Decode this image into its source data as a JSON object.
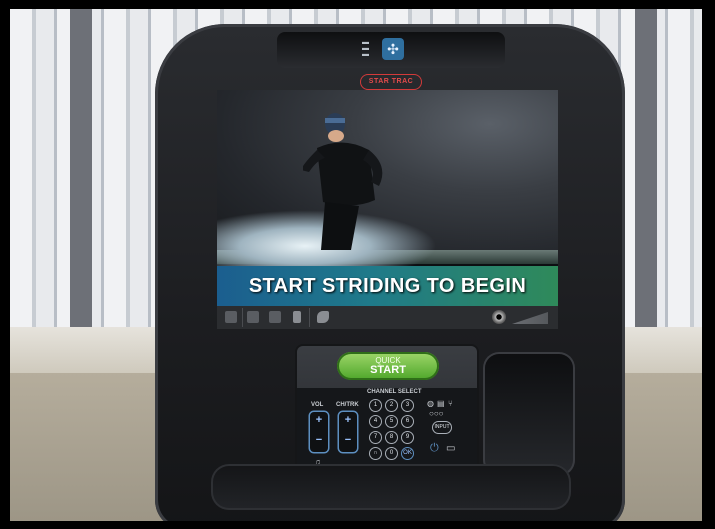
{
  "console": {
    "brand_logo": "STAR TRAC",
    "fan_icon": "fan-icon",
    "screen": {
      "banner_text": "START STRIDING TO BEGIN",
      "status_icons": [
        "home-icon",
        "grid-icon",
        "screen-icon",
        "device-icon",
        "runner-icon"
      ],
      "media_icon": "disc-icon",
      "volume_icon": "volume-wedge-icon"
    },
    "controls": {
      "quick_start": {
        "line1": "QUICK",
        "line2": "START"
      },
      "channel_select_label": "CHANNEL SELECT",
      "vol_label": "VOL",
      "chtrk_label": "CH/TRK",
      "plus": "+",
      "minus": "−",
      "keypad": [
        "1",
        "2",
        "3",
        "4",
        "5",
        "6",
        "7",
        "8",
        "9",
        "∩",
        "0",
        "OK"
      ],
      "input_label": "INPUT",
      "headphone_icon": "headphone-icon",
      "power_icon": "power-icon",
      "tv_icon": "tv-icon",
      "usb_icon": "usb-icon"
    }
  },
  "colors": {
    "banner_start": "#1b5e8f",
    "banner_end": "#2f8a5a",
    "quick_start_green": "#4ea62a",
    "accent_blue": "#5d8fc0",
    "logo_red": "#e34b4b"
  }
}
